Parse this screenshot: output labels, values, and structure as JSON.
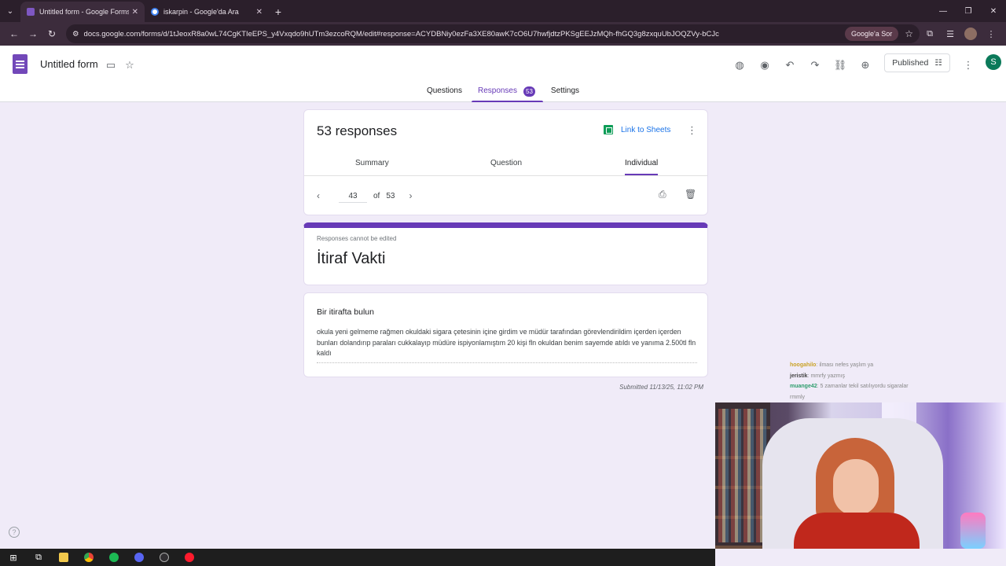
{
  "browser": {
    "tabs": [
      {
        "title": "Untitled form - Google Forms",
        "active": true
      },
      {
        "title": "iskarpin - Google'da Ara",
        "active": false
      }
    ],
    "url": "docs.google.com/forms/d/1tJeoxR8a0wL74CgKTIeEPS_y4Vxqdo9hUTm3ezcoRQM/edit#response=ACYDBNiy0ezFa3XE80awK7cO6U7hwfjdtzPKSgEEJzMQh-fhGQ3g8zxquUbJOQZVy-bCJc",
    "ask_google": "Google'a Sor"
  },
  "forms_header": {
    "title": "Untitled form",
    "published_label": "Published",
    "avatar_letter": "S",
    "tabs": {
      "questions": "Questions",
      "responses": "Responses",
      "responses_count": "53",
      "settings": "Settings"
    }
  },
  "responses_card": {
    "count_label": "53 responses",
    "link_sheets": "Link to Sheets",
    "subtabs": {
      "summary": "Summary",
      "question": "Question",
      "individual": "Individual"
    },
    "pager": {
      "current": "43",
      "of": "of",
      "total": "53"
    }
  },
  "form_card": {
    "note": "Responses cannot be edited",
    "heading": "İtiraf Vakti"
  },
  "question_card": {
    "question": "Bir itirafta bulun",
    "answer": "okula yeni gelmeme rağmen okuldaki sigara çetesinin içine girdim ve müdür tarafından görevlendirildim içerden içerden bunları dolandırıp paraları cukkalayıp müdüre ispiyonlamıştım 20 kişi fln okuldan benim sayemde atıldı ve yanıma 2.500tl fln kaldı"
  },
  "submitted": "Submitted 11/13/25, 11:02 PM",
  "chat": [
    {
      "user": "hoogahilo",
      "message": ": ilması nefes yaşlım ya"
    },
    {
      "user": "jeristik",
      "message": ": mmrfy yazmış"
    },
    {
      "user": "muange42",
      "message": ": 5 zamanlar tekil satılıyordu sigaralar"
    },
    {
      "user": "",
      "message": "rmmly"
    }
  ],
  "colors": {
    "accent": "#673ab7",
    "background": "#f0ebf8",
    "sheets_green": "#0f9d58",
    "browser_chrome": "#3c2c3c"
  }
}
